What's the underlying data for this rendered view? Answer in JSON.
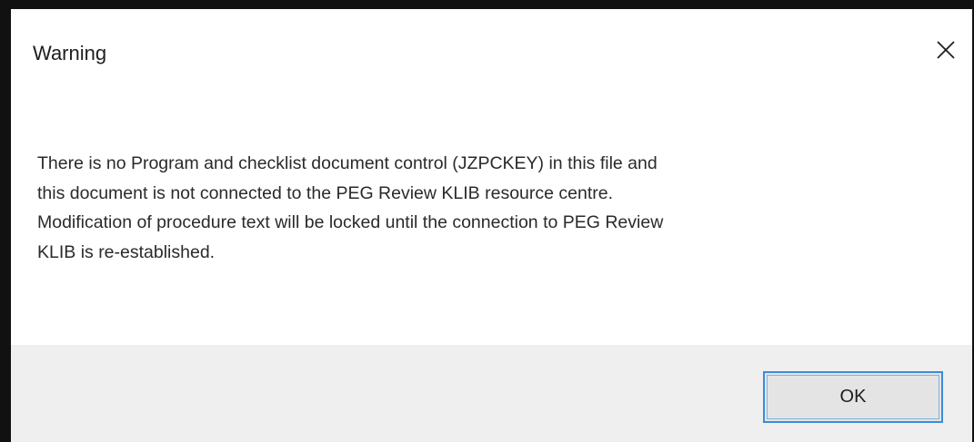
{
  "dialog": {
    "title": "Warning",
    "close_icon": "close-icon",
    "message_lines": [
      "There is no Program and checklist document control (JZPCKEY) in this file and",
      "this document is not connected to the PEG Review KLIB resource centre.",
      "Modification of procedure text will be locked until the connection to PEG Review",
      "KLIB is re-established."
    ],
    "ok_label": "OK",
    "colors": {
      "accent_border": "#3c8cd8",
      "footer_bg": "#efefef",
      "window_frame": "#111111"
    }
  }
}
